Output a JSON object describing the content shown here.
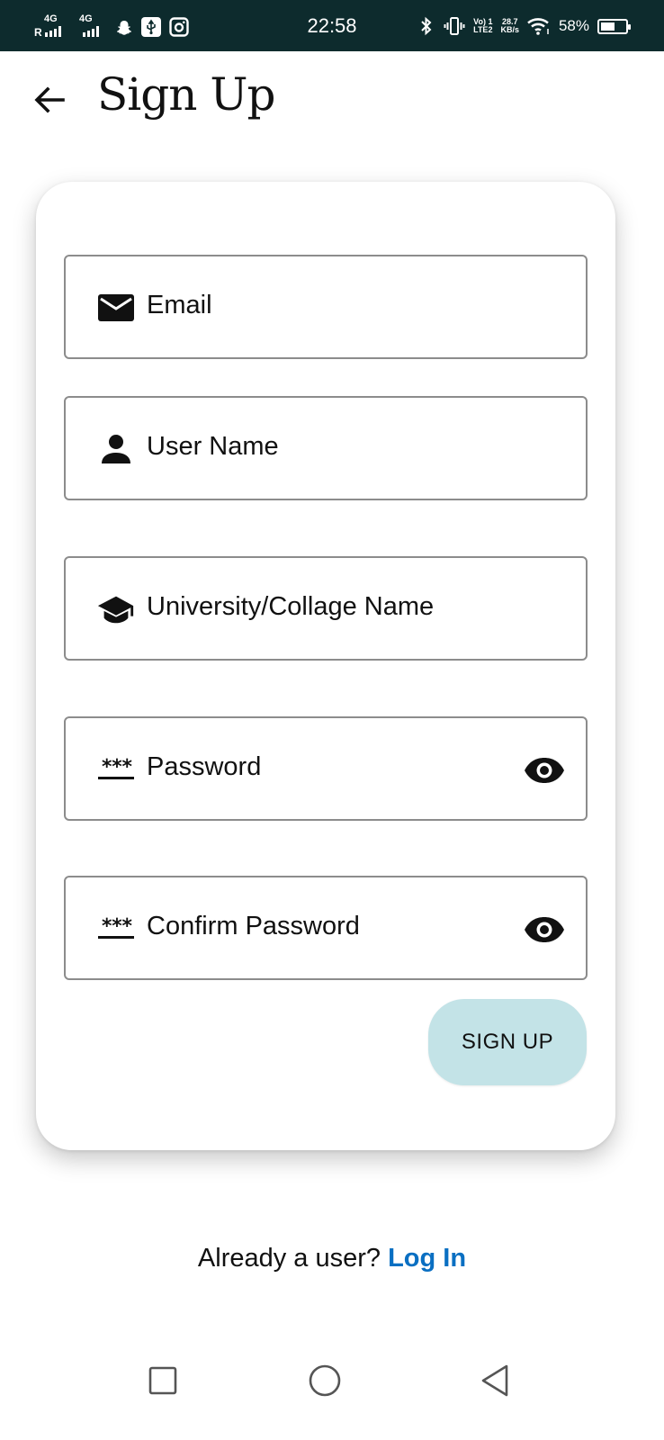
{
  "status_bar": {
    "time": "22:58",
    "sim1_network": "4G",
    "sim1_roaming": "R",
    "sim2_network": "4G",
    "volte_top": "Vo) 1",
    "volte_bottom": "LTE2",
    "speed_value": "28.7",
    "speed_unit": "KB/s",
    "battery_percent": "58%",
    "battery_level": 0.58,
    "icons": [
      "signal-icon",
      "signal-icon",
      "snapchat-icon",
      "usb-debug-icon",
      "instagram-icon",
      "bluetooth-icon",
      "vibrate-icon",
      "wifi-icon",
      "battery-icon"
    ]
  },
  "header": {
    "title": "Sign Up",
    "back_icon": "arrow-left-icon"
  },
  "form": {
    "fields": [
      {
        "icon": "mail-icon",
        "placeholder": "Email"
      },
      {
        "icon": "person-icon",
        "placeholder": "User Name"
      },
      {
        "icon": "school-icon",
        "placeholder": "University/Collage Name"
      },
      {
        "icon": "password-icon",
        "placeholder": "Password",
        "password_icon_text": "***",
        "toggle_icon": "eye-icon"
      },
      {
        "icon": "password-icon",
        "placeholder": "Confirm Password",
        "password_icon_text": "***",
        "toggle_icon": "eye-icon"
      }
    ],
    "submit_label": "SIGN UP",
    "submit_color": "#c3e3e7"
  },
  "footer": {
    "prompt": "Already a user?",
    "link": "Log In",
    "link_color": "#0a6fc2"
  },
  "nav": {
    "icons": [
      "recent-apps-icon",
      "home-icon",
      "back-icon"
    ]
  },
  "colors": {
    "status_bar_bg": "#0d2b2d",
    "field_border": "#8c8c8c"
  }
}
